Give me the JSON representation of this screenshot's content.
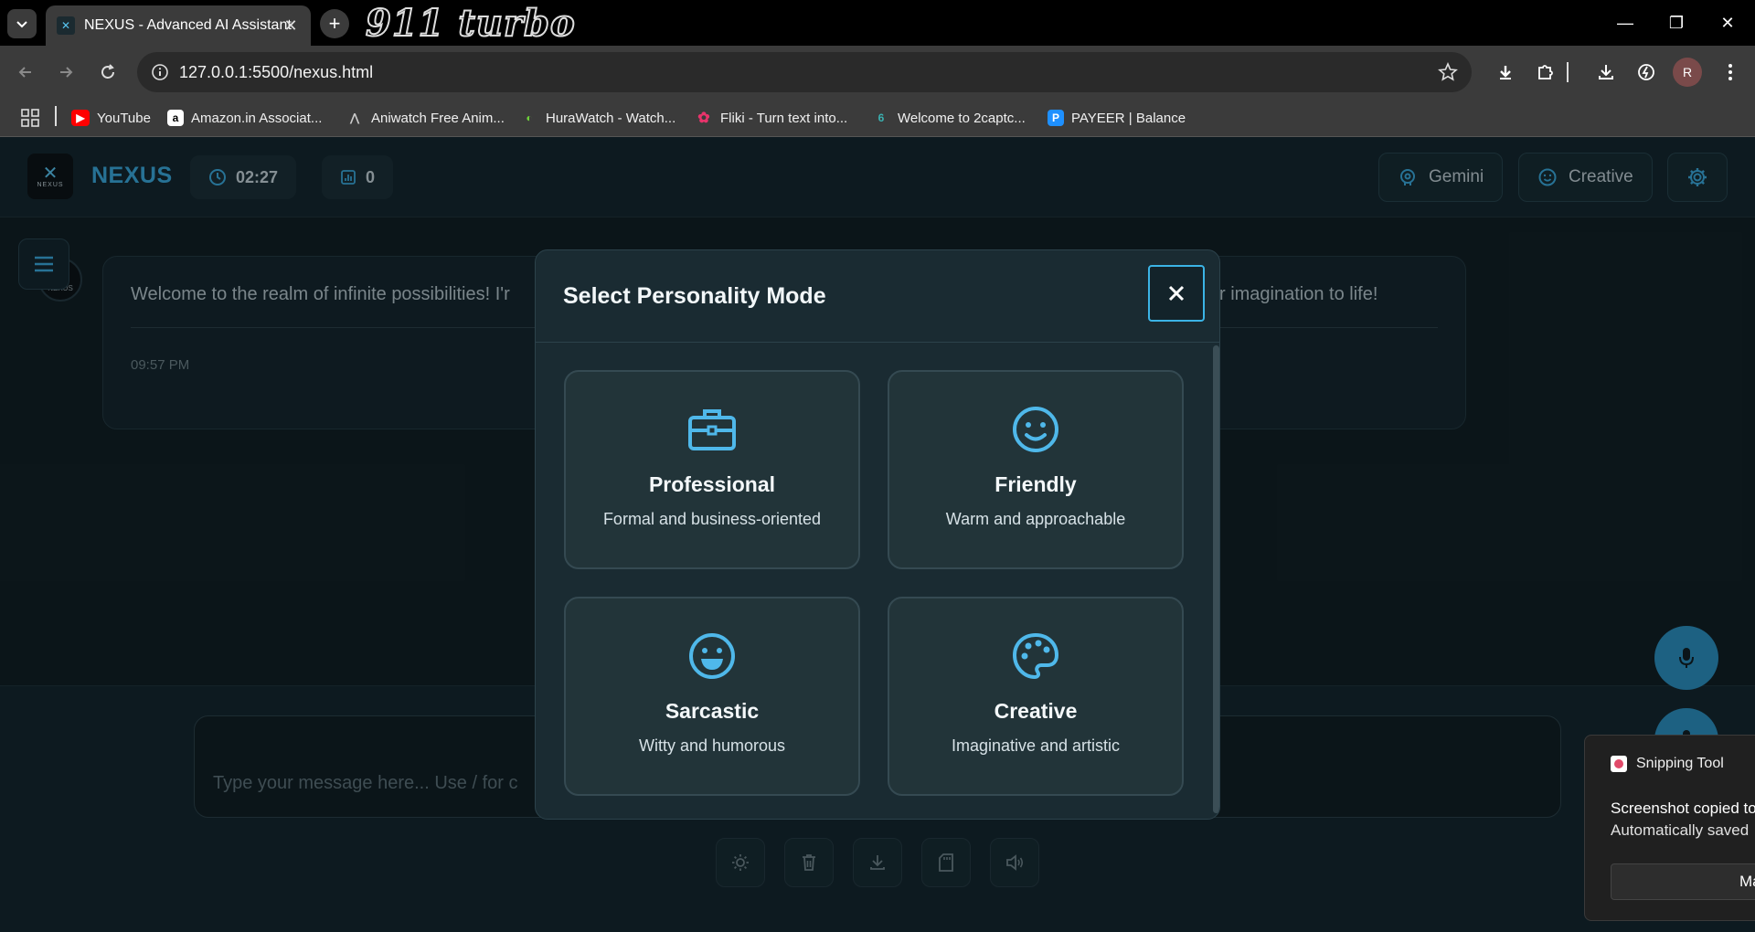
{
  "browser": {
    "tab_title": "NEXUS - Advanced AI Assistant",
    "brand_text": "911 turbo",
    "url": "127.0.0.1:5500/nexus.html",
    "profile_initial": "R",
    "bookmarks": [
      {
        "label": "YouTube",
        "icon": "youtube-icon",
        "color": "#ff0000"
      },
      {
        "label": "Amazon.in Associat...",
        "icon": "amazon-icon",
        "color": "#ffffff"
      },
      {
        "label": "Aniwatch Free Anim...",
        "icon": "aniwatch-icon",
        "color": "#cccccc"
      },
      {
        "label": "HuraWatch - Watch...",
        "icon": "hurawatch-icon",
        "color": "#6fd33a"
      },
      {
        "label": "Fliki - Turn text into...",
        "icon": "fliki-icon",
        "color": "#e8336b"
      },
      {
        "label": "Welcome to 2captc...",
        "icon": "2captcha-icon",
        "color": "#3ab0b0"
      },
      {
        "label": "PAYEER | Balance",
        "icon": "payeer-icon",
        "color": "#1e90ff"
      }
    ]
  },
  "app": {
    "logo_sub": "NEXUS",
    "name": "NEXUS",
    "timer": "02:27",
    "message_count": "0",
    "model_label": "Gemini",
    "mode_label": "Creative",
    "accent": "#3aa9de"
  },
  "chat": {
    "avatar_label": "NEXUS",
    "message_left": "Welcome to the realm of infinite possibilities! I'r",
    "message_right": "your imagination to life!",
    "message_time": "09:57 PM",
    "input_placeholder": "Type your message here... Use / for c"
  },
  "modal": {
    "title": "Select Personality Mode",
    "modes": [
      {
        "name": "Professional",
        "desc": "Formal and business-oriented",
        "icon": "briefcase-icon"
      },
      {
        "name": "Friendly",
        "desc": "Warm and approachable",
        "icon": "smile-icon"
      },
      {
        "name": "Sarcastic",
        "desc": "Witty and humorous",
        "icon": "grin-icon"
      },
      {
        "name": "Creative",
        "desc": "Imaginative and artistic",
        "icon": "palette-icon"
      }
    ]
  },
  "toast": {
    "app": "Snipping Tool",
    "line1": "Screenshot copied to",
    "line2": "Automatically saved",
    "button": "Ma"
  }
}
